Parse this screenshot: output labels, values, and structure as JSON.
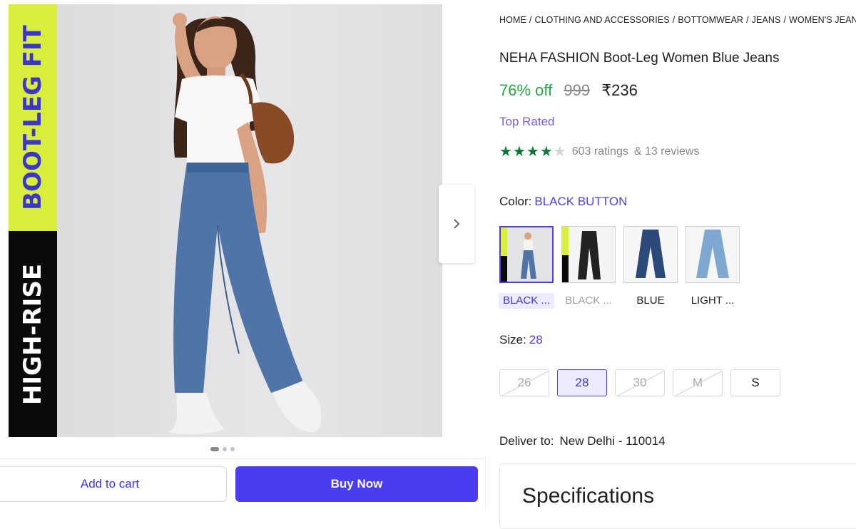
{
  "gallery": {
    "band_top_text": "BOOT-LEG FIT",
    "band_bottom_text": "HIGH-RISE",
    "dots_count": 3,
    "active_dot": 0
  },
  "actions": {
    "add_to_cart": "Add to cart",
    "buy_now": "Buy Now"
  },
  "breadcrumb": [
    "HOME",
    "CLOTHING AND ACCESSORIES",
    "BOTTOMWEAR",
    "JEANS",
    "WOMEN'S JEANS"
  ],
  "product": {
    "title": "NEHA FASHION Boot-Leg Women Blue Jeans",
    "discount": "76% off",
    "mrp": "999",
    "price": "₹236",
    "badge": "Top Rated",
    "rating_value": 4,
    "ratings_text": "603 ratings",
    "reviews_text": "& 13 reviews"
  },
  "color": {
    "label": "Color:",
    "selected": "BLACK BUTTON",
    "options": [
      {
        "label": "BLACK ...",
        "state": "selected"
      },
      {
        "label": "BLACK ...",
        "state": "muted"
      },
      {
        "label": "BLUE",
        "state": "normal"
      },
      {
        "label": "LIGHT ...",
        "state": "normal"
      }
    ]
  },
  "size": {
    "label": "Size:",
    "selected": "28",
    "options": [
      {
        "label": "26",
        "state": "unavailable"
      },
      {
        "label": "28",
        "state": "selected"
      },
      {
        "label": "30",
        "state": "unavailable"
      },
      {
        "label": "M",
        "state": "unavailable"
      },
      {
        "label": "S",
        "state": "available"
      }
    ]
  },
  "delivery": {
    "label": "Deliver to:",
    "location": "New Delhi - 110014"
  },
  "specifications": {
    "title": "Specifications"
  },
  "colors": {
    "accent": "#4a3cf0",
    "discount_green": "#26a541",
    "star_green": "#0d7a3a",
    "band_lime": "#d8ee3a"
  }
}
